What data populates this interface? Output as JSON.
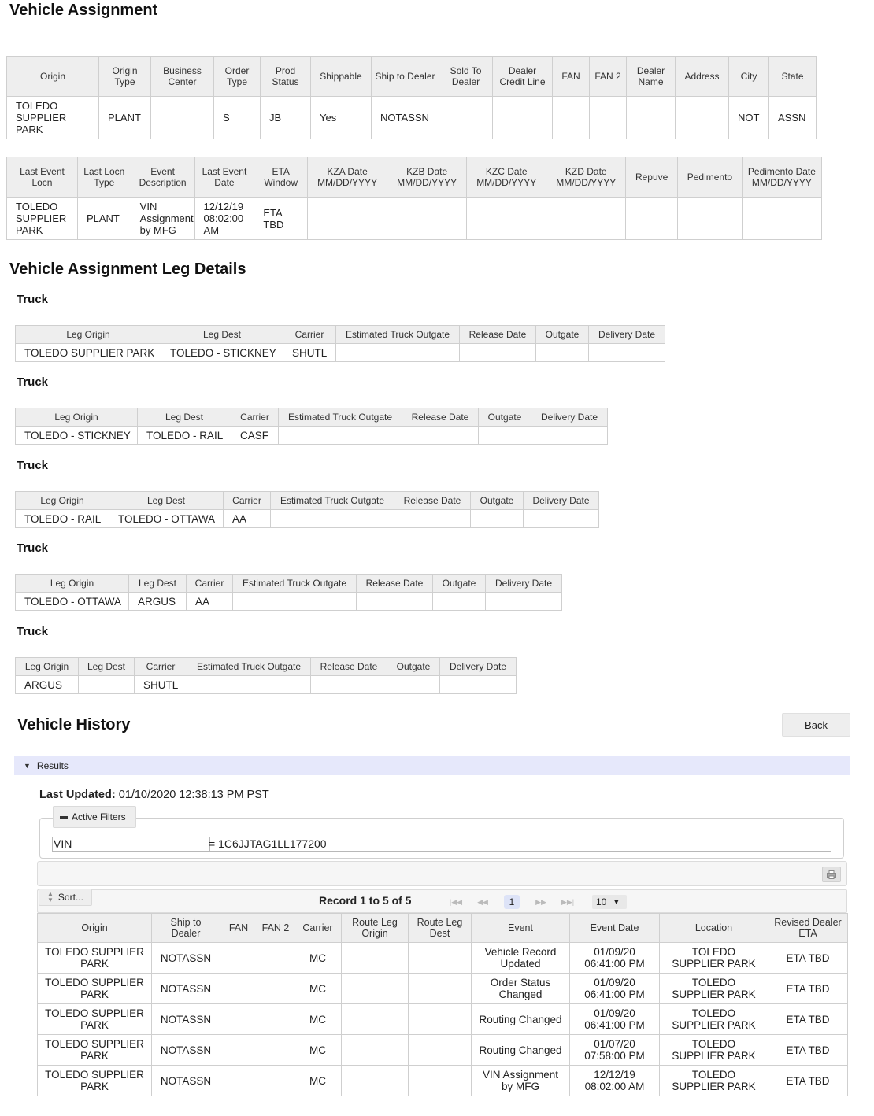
{
  "sections": {
    "vehicle_assignment": "Vehicle Assignment",
    "leg_details": "Vehicle Assignment Leg Details",
    "vehicle_history": "Vehicle History"
  },
  "assignment_table_1": {
    "headers": [
      "Origin",
      "Origin Type",
      "Business Center",
      "Order Type",
      "Prod Status",
      "Shippable",
      "Ship to Dealer",
      "Sold To Dealer",
      "Dealer Credit Line",
      "FAN",
      "FAN 2",
      "Dealer Name",
      "Address",
      "City",
      "State"
    ],
    "row": [
      "TOLEDO SUPPLIER PARK",
      "PLANT",
      "",
      "S",
      "JB",
      "Yes",
      "NOTASSN",
      "",
      "",
      "",
      "",
      "",
      "",
      "NOT",
      "ASSN"
    ]
  },
  "assignment_table_2": {
    "headers": [
      "Last Event Locn",
      "Last Locn Type",
      "Event Description",
      "Last Event Date",
      "ETA Window",
      "KZA Date MM/DD/YYYY",
      "KZB Date MM/DD/YYYY",
      "KZC Date MM/DD/YYYY",
      "KZD Date MM/DD/YYYY",
      "Repuve",
      "Pedimento",
      "Pedimento Date MM/DD/YYYY"
    ],
    "row": [
      "TOLEDO SUPPLIER PARK",
      "PLANT",
      "VIN Assignment by MFG",
      "12/12/19 08:02:00 AM",
      "ETA TBD",
      "",
      "",
      "",
      "",
      "",
      "",
      ""
    ]
  },
  "legs": [
    {
      "label": "Truck",
      "headers": [
        "Leg Origin",
        "Leg Dest",
        "Carrier",
        "Estimated Truck Outgate",
        "Release Date",
        "Outgate",
        "Delivery Date"
      ],
      "row": [
        "TOLEDO SUPPLIER PARK",
        "TOLEDO - STICKNEY",
        "SHUTL",
        "",
        "",
        "",
        ""
      ]
    },
    {
      "label": "Truck",
      "headers": [
        "Leg Origin",
        "Leg Dest",
        "Carrier",
        "Estimated Truck Outgate",
        "Release Date",
        "Outgate",
        "Delivery Date"
      ],
      "row": [
        "TOLEDO - STICKNEY",
        "TOLEDO - RAIL",
        "CASF",
        "",
        "",
        "",
        ""
      ]
    },
    {
      "label": "Truck",
      "headers": [
        "Leg Origin",
        "Leg Dest",
        "Carrier",
        "Estimated Truck Outgate",
        "Release Date",
        "Outgate",
        "Delivery Date"
      ],
      "row": [
        "TOLEDO - RAIL",
        "TOLEDO - OTTAWA",
        "AA",
        "",
        "",
        "",
        ""
      ]
    },
    {
      "label": "Truck",
      "headers": [
        "Leg Origin",
        "Leg Dest",
        "Carrier",
        "Estimated Truck Outgate",
        "Release Date",
        "Outgate",
        "Delivery Date"
      ],
      "row": [
        "TOLEDO - OTTAWA",
        "ARGUS",
        "AA",
        "",
        "",
        "",
        ""
      ]
    },
    {
      "label": "Truck",
      "headers": [
        "Leg Origin",
        "Leg Dest",
        "Carrier",
        "Estimated Truck Outgate",
        "Release Date",
        "Outgate",
        "Delivery Date"
      ],
      "row": [
        "ARGUS",
        "",
        "SHUTL",
        "",
        "",
        "",
        ""
      ]
    }
  ],
  "history": {
    "back_label": "Back",
    "results_label": "Results",
    "last_updated_label": "Last Updated:",
    "last_updated_value": "01/10/2020 12:38:13 PM PST",
    "active_filters_label": "Active Filters",
    "filter_name": "VIN",
    "filter_value": "= 1C6JJTAG1LL177200",
    "sort_label": "Sort...",
    "record_label": "Record 1 to 5 of 5",
    "current_page": "1",
    "page_size": "10",
    "headers": [
      "Origin",
      "Ship to Dealer",
      "FAN",
      "FAN 2",
      "Carrier",
      "Route Leg Origin",
      "Route Leg Dest",
      "Event",
      "Event Date",
      "Location",
      "Revised Dealer ETA"
    ],
    "rows": [
      [
        "TOLEDO SUPPLIER PARK",
        "NOTASSN",
        "",
        "",
        "MC",
        "",
        "",
        "Vehicle Record Updated",
        "01/09/20 06:41:00 PM",
        "TOLEDO SUPPLIER PARK",
        "ETA TBD"
      ],
      [
        "TOLEDO SUPPLIER PARK",
        "NOTASSN",
        "",
        "",
        "MC",
        "",
        "",
        "Order Status Changed",
        "01/09/20 06:41:00 PM",
        "TOLEDO SUPPLIER PARK",
        "ETA TBD"
      ],
      [
        "TOLEDO SUPPLIER PARK",
        "NOTASSN",
        "",
        "",
        "MC",
        "",
        "",
        "Routing Changed",
        "01/09/20 06:41:00 PM",
        "TOLEDO SUPPLIER PARK",
        "ETA TBD"
      ],
      [
        "TOLEDO SUPPLIER PARK",
        "NOTASSN",
        "",
        "",
        "MC",
        "",
        "",
        "Routing Changed",
        "01/07/20 07:58:00 PM",
        "TOLEDO SUPPLIER PARK",
        "ETA TBD"
      ],
      [
        "TOLEDO SUPPLIER PARK",
        "NOTASSN",
        "",
        "",
        "MC",
        "",
        "",
        "VIN Assignment by MFG",
        "12/12/19 08:02:00 AM",
        "TOLEDO SUPPLIER PARK",
        "ETA TBD"
      ]
    ]
  }
}
